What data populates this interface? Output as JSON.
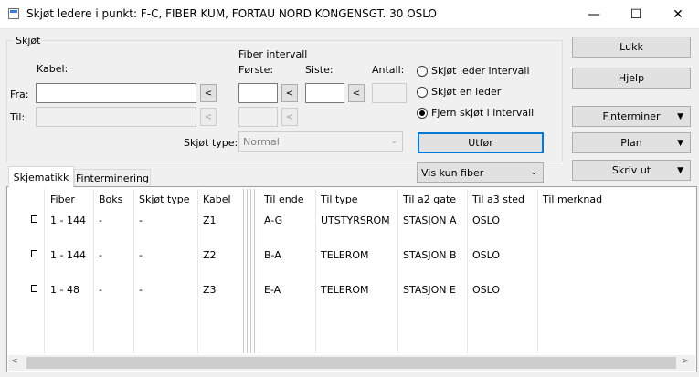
{
  "window": {
    "title": "Skjøt ledere i punkt: F-C, FIBER KUM, FORTAU NORD KONGENSGT. 30 OSLO",
    "minimize": "—",
    "maximize": "☐",
    "close": "✕"
  },
  "group": {
    "title": "Skjøt",
    "kabel_label": "Kabel:",
    "fra_label": "Fra:",
    "til_label": "Til:",
    "fra_value": "",
    "til_value": "",
    "fiber_intervall_label": "Fiber intervall",
    "forste_label": "Første:",
    "siste_label": "Siste:",
    "antall_label": "Antall:",
    "picker_glyph": "<",
    "skjot_type_label": "Skjøt type:",
    "skjot_type_value": "Normal",
    "radios": [
      {
        "label": "Skjøt leder intervall",
        "selected": false
      },
      {
        "label": "Skjøt en leder",
        "selected": false
      },
      {
        "label": "Fjern skjøt i intervall",
        "selected": true
      }
    ],
    "utfor_label": "Utfør"
  },
  "side_buttons": {
    "lukk": "Lukk",
    "hjelp": "Hjelp",
    "finterminer": "Finterminer",
    "plan": "Plan",
    "skriv_ut": "Skriv ut"
  },
  "tabs": [
    {
      "label": "Skjematikk",
      "active": true
    },
    {
      "label": "Finterminering",
      "active": false
    }
  ],
  "filter": {
    "value": "Vis kun fiber"
  },
  "table": {
    "columns": [
      "Fiber",
      "Boks",
      "Skjøt type",
      "Kabel",
      "Til ende",
      "Til type",
      "Til a2 gate",
      "Til a3 sted",
      "Til merknad"
    ],
    "rows": [
      {
        "fiber": "1 - 144",
        "boks": "-",
        "skjot_type": "-",
        "kabel": "Z1",
        "til_ende": "A-G",
        "til_type": "UTSTYRSROM",
        "til_a2": "STASJON A",
        "til_a3": "OSLO",
        "til_merknad": ""
      },
      {
        "fiber": "1 - 144",
        "boks": "-",
        "skjot_type": "-",
        "kabel": "Z2",
        "til_ende": "B-A",
        "til_type": "TELEROM",
        "til_a2": "STASJON B",
        "til_a3": "OSLO",
        "til_merknad": ""
      },
      {
        "fiber": "1 - 48",
        "boks": "-",
        "skjot_type": "-",
        "kabel": "Z3",
        "til_ende": "E-A",
        "til_type": "TELEROM",
        "til_a2": "STASJON E",
        "til_a3": "OSLO",
        "til_merknad": ""
      }
    ]
  },
  "scrollbar": {
    "left_arrow": "<",
    "right_arrow": ">"
  }
}
